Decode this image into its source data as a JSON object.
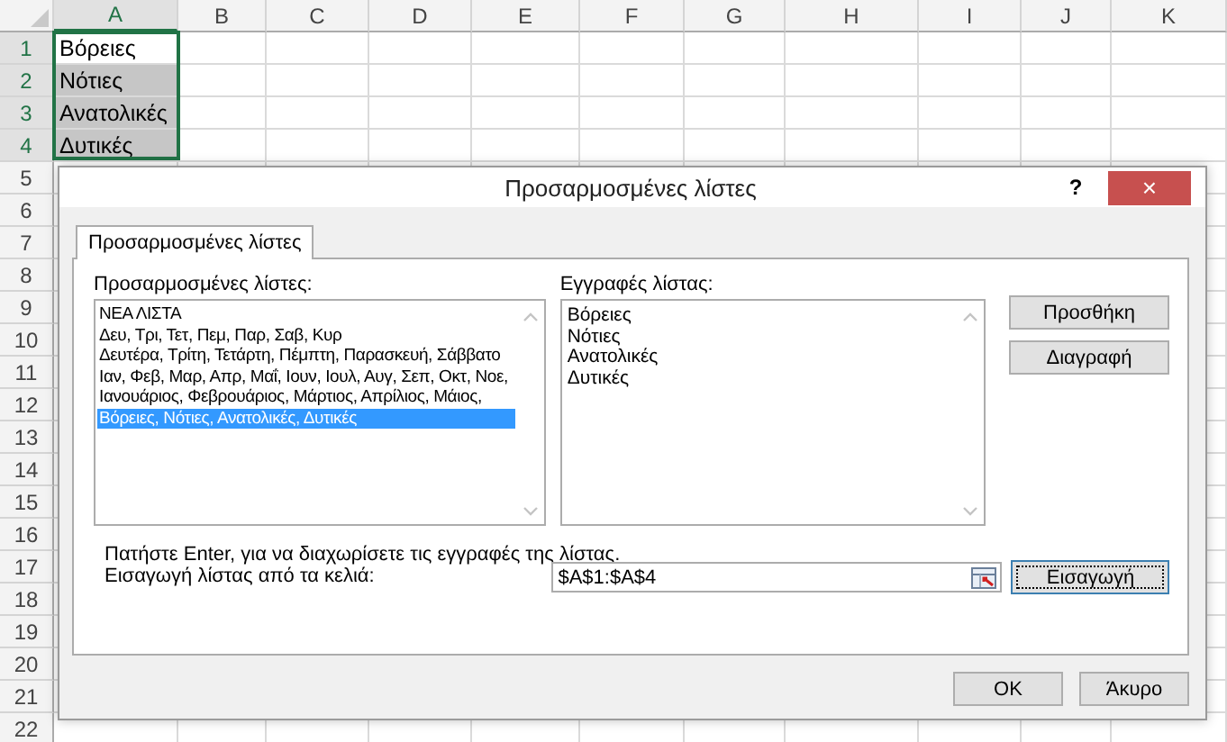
{
  "sheet": {
    "columns": [
      "A",
      "B",
      "C",
      "D",
      "E",
      "F",
      "G",
      "H",
      "I",
      "J",
      "K"
    ],
    "rows": [
      "1",
      "2",
      "3",
      "4",
      "5",
      "6",
      "7",
      "8",
      "9",
      "10",
      "11",
      "12",
      "13",
      "14",
      "15",
      "16",
      "17",
      "18",
      "19",
      "20",
      "21",
      "22"
    ],
    "cells": [
      {
        "value": "Βόρειες",
        "selected": false
      },
      {
        "value": "Νότιες",
        "selected": true
      },
      {
        "value": "Ανατολικές",
        "selected": true
      },
      {
        "value": "Δυτικές",
        "selected": true
      }
    ]
  },
  "dialog": {
    "title": "Προσαρμοσμένες λίστες",
    "help": "?",
    "close": "×",
    "tabs": [
      {
        "label": "Προσαρμοσμένες λίστες",
        "selected": true
      }
    ],
    "lists_label": "Προσαρμοσμένες λίστες:",
    "lists": [
      {
        "text": "ΝΕΑ ΛΙΣΤΑ",
        "selected": false
      },
      {
        "text": "Δευ, Τρι, Τετ, Πεμ, Παρ, Σαβ, Κυρ",
        "selected": false
      },
      {
        "text": "Δευτέρα, Τρίτη, Τετάρτη, Πέμπτη, Παρασκευή, Σάββατο",
        "selected": false
      },
      {
        "text": "Ιαν, Φεβ, Μαρ, Απρ, Μαΐ, Ιουν, Ιουλ, Αυγ, Σεπ, Οκτ, Νοε,",
        "selected": false
      },
      {
        "text": "Ιανουάριος, Φεβρουάριος, Μάρτιος, Απρίλιος, Μάιος,",
        "selected": false
      },
      {
        "text": "Βόρειες, Νότιες, Ανατολικές, Δυτικές",
        "selected": true
      }
    ],
    "entries_label": "Εγγραφές λίστας:",
    "entries": [
      "Βόρειες",
      "Νότιες",
      "Ανατολικές",
      "Δυτικές"
    ],
    "side_buttons": [
      "Προσθήκη",
      "Διαγραφή"
    ],
    "hint": "Πατήστε Enter, για να διαχωρίσετε τις εγγραφές της λίστας.",
    "import_label": "Εισαγωγή λίστας από τα κελιά:",
    "import_value": "$A$1:$A$4",
    "import_button": "Εισαγωγή",
    "buttons": [
      "OK",
      "Άκυρο"
    ]
  }
}
